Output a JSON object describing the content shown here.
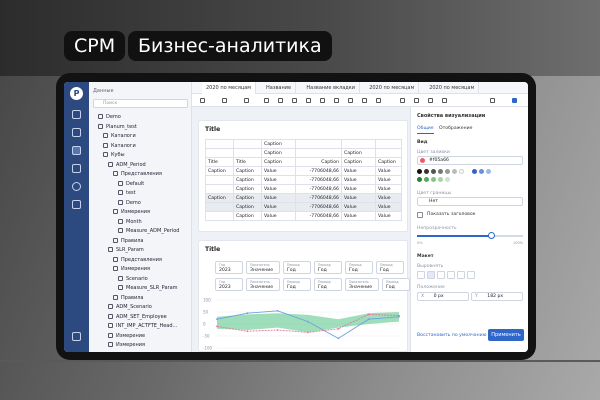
{
  "header": {
    "pill1": "CPM",
    "pill2": "Бизнес-аналитика"
  },
  "sidebar": {
    "title": "Данные",
    "search_placeholder": "Поиск",
    "items": [
      {
        "label": "Demo"
      },
      {
        "label": "Planum_test"
      },
      {
        "label": "Каталоги"
      },
      {
        "label": "Каталоги"
      },
      {
        "label": "Кубы"
      },
      {
        "label": "ADM_Period"
      },
      {
        "label": "Представления"
      },
      {
        "label": "Default"
      },
      {
        "label": "test"
      },
      {
        "label": "Demo"
      },
      {
        "label": "Измерения"
      },
      {
        "label": "Month"
      },
      {
        "label": "Measure_ADM_Period"
      },
      {
        "label": "Правила"
      },
      {
        "label": "SLR_Param"
      },
      {
        "label": "Представления"
      },
      {
        "label": "Измерения"
      },
      {
        "label": "Scenario"
      },
      {
        "label": "Measure_SLR_Param"
      },
      {
        "label": "Правила"
      },
      {
        "label": "ADM_Scenario"
      },
      {
        "label": "ADM_SET_Employee"
      },
      {
        "label": "INT_IMP_ACTFTE_Head..."
      },
      {
        "label": "Измерение"
      },
      {
        "label": "Измерения"
      }
    ]
  },
  "tabs": [
    "2020 по месяцам",
    "Название",
    "Название вкладки",
    "2020 по месяцам",
    "2020 по месяцам"
  ],
  "pivot": {
    "title": "Title",
    "rows": [
      [
        "",
        "",
        "Caption",
        "",
        "",
        ""
      ],
      [
        "",
        "",
        "Caption",
        "",
        "Caption",
        ""
      ],
      [
        "Title",
        "Title",
        "Caption",
        "Caption",
        "Caption",
        "Caption"
      ],
      [
        "Caption",
        "Caption",
        "Value",
        "-7706048,66",
        "Value",
        "Value"
      ],
      [
        "",
        "Caption",
        "Value",
        "-7706048,66",
        "Value",
        "Value"
      ],
      [
        "",
        "Caption",
        "Value",
        "-7706048,66",
        "Value",
        "Value"
      ],
      [
        "Caption",
        "Caption",
        "Value",
        "-7706048,66",
        "Value",
        "Value"
      ],
      [
        "",
        "Caption",
        "Value",
        "-7706048,66",
        "Value",
        "Value"
      ],
      [
        "",
        "Caption",
        "Value",
        "-7706048,66",
        "Value",
        "Value"
      ]
    ]
  },
  "chart_panel": {
    "title": "Title",
    "filters": [
      {
        "label": "Год",
        "value": "2023"
      },
      {
        "label": "Показатель",
        "value": "Значение"
      },
      {
        "label": "Период",
        "value": "Год"
      },
      {
        "label": "Период",
        "value": "Год"
      },
      {
        "label": "Период",
        "value": "Год"
      },
      {
        "label": "Период",
        "value": "Год"
      }
    ],
    "filters2": [
      {
        "label": "Год",
        "value": "2023"
      },
      {
        "label": "Показатель",
        "value": "Значение"
      },
      {
        "label": "Период",
        "value": "Год"
      },
      {
        "label": "Период",
        "value": "Год"
      },
      {
        "label": "Показатель",
        "value": "Значение"
      },
      {
        "label": "Период",
        "value": "Год"
      }
    ]
  },
  "chart_data": {
    "type": "line",
    "yticks": [
      "100",
      "50",
      "0",
      "-50",
      "-100"
    ],
    "ylim": [
      -100,
      100
    ],
    "series": [
      {
        "values": [
          20,
          45,
          55,
          10,
          -60,
          20,
          30
        ],
        "color": "#6ea0e0"
      },
      {
        "values": [
          -10,
          -30,
          -25,
          -35,
          -20,
          40,
          35
        ],
        "color": "#e07aa0"
      }
    ],
    "band": {
      "upper": [
        30,
        40,
        45,
        38,
        20,
        45,
        50
      ],
      "lower": [
        -20,
        -25,
        -15,
        -35,
        -15,
        0,
        10
      ],
      "color": "#7fd3a3"
    }
  },
  "props": {
    "title": "Свойства визуализации",
    "tab_general": "Общие",
    "tab_display": "Отображение",
    "section_view": "Вид",
    "fill_label": "Цвет заливки",
    "fill_value": "#f05a66",
    "border_label": "Цвет границы",
    "border_value": "Нет",
    "show_header": "Показать заголовок",
    "opacity_label": "Непрозрачность",
    "opacity_min": "0%",
    "opacity_max": "100%",
    "opacity": 0.7,
    "section_layout": "Макет",
    "align_label": "Выровнять",
    "position_label": "Положение",
    "x_label": "X",
    "x_value": "0 px",
    "y_label": "Y",
    "y_value": "182 px",
    "reset": "Восстановить по умолчанию",
    "apply": "Применить",
    "swatches": [
      "#111111",
      "#333333",
      "#555555",
      "#777777",
      "#999999",
      "#bbbbbb",
      "#ffffff",
      "#3a5fcc",
      "#6d8fe0",
      "#9fb7ee",
      "#2e7d32",
      "#4caf50",
      "#81c784",
      "#a5d6a7",
      "#c8e6c9"
    ]
  }
}
